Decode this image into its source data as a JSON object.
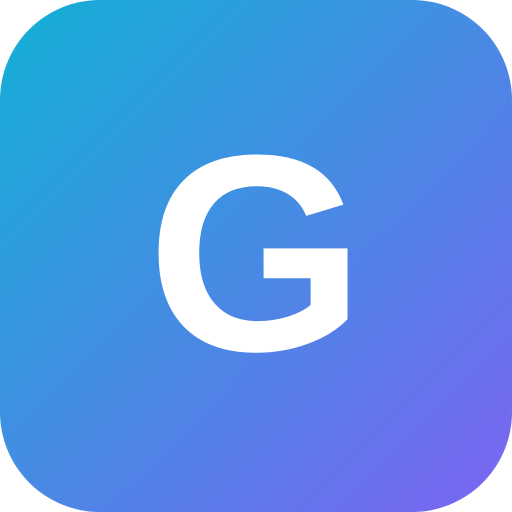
{
  "app_icon": {
    "letter": "G",
    "gradient_start": "#12B0D6",
    "gradient_end": "#7C64F2",
    "letter_color": "#FFFFFF"
  }
}
